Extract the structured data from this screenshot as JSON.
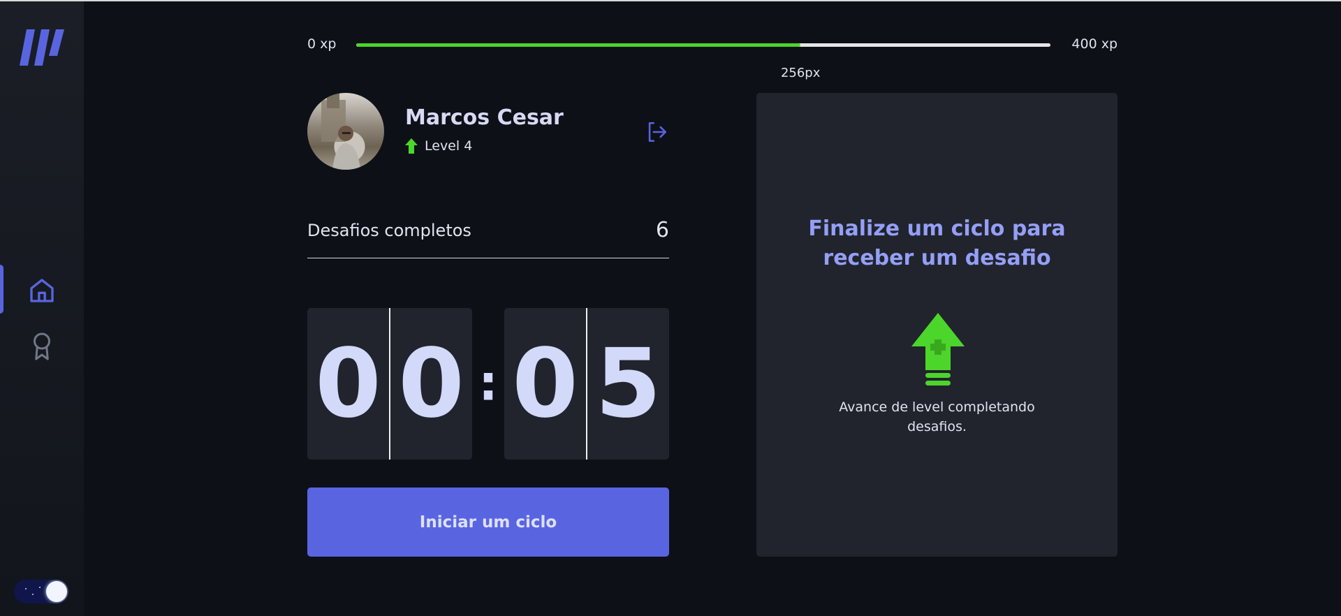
{
  "xp": {
    "min_label": "0 xp",
    "max_label": "400 xp",
    "current_label": "256px",
    "progress_fraction": 0.64
  },
  "profile": {
    "name": "Marcos Cesar",
    "level_label": "Level 4",
    "avatar_icon": "user-photo"
  },
  "sidebar": {
    "logo_icon": "brand-stripes-logo",
    "items": [
      {
        "name": "home",
        "icon": "home-icon",
        "active": true
      },
      {
        "name": "award",
        "icon": "award-icon",
        "active": false
      }
    ],
    "theme_toggle": {
      "state": "dark"
    }
  },
  "completed": {
    "label": "Desafios completos",
    "count": "6"
  },
  "countdown": {
    "minute_left": "0",
    "minute_right": "0",
    "separator": ":",
    "second_left": "0",
    "second_right": "5"
  },
  "start_button": {
    "label": "Iniciar um ciclo"
  },
  "challenge_card": {
    "title": "Finalize um ciclo para receber um desafio",
    "description": "Avance de level completando desafios.",
    "icon": "level-up-arrow-icon"
  },
  "colors": {
    "accent": "#5965e0",
    "success": "#4cd62b",
    "card_title": "#949ff6",
    "background": "#0d1017",
    "card": "#21242d"
  }
}
